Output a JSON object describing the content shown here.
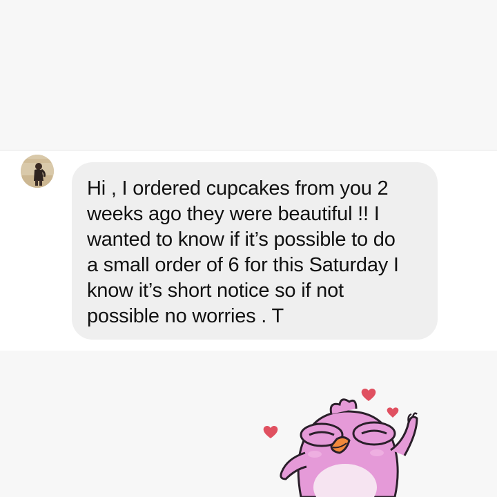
{
  "conversation": {
    "message": {
      "text": "Hi , I ordered cupcakes from you 2\nweeks ago they were beautiful !! I\nwanted to know if it’s possible to do\na small order of 6 for this Saturday I\nknow it’s short notice so if not\npossible no worries . T",
      "bubble_color": "#efefef"
    },
    "sender_avatar_icon": "user-avatar",
    "sticker_icon": "pink-bird-hearts-sticker"
  },
  "colors": {
    "background": "#f7f7f7",
    "message_row_background": "#ffffff",
    "sticker_pink": "#e59ad8",
    "heart_red": "#e05060",
    "beak_orange": "#f28a3c"
  }
}
